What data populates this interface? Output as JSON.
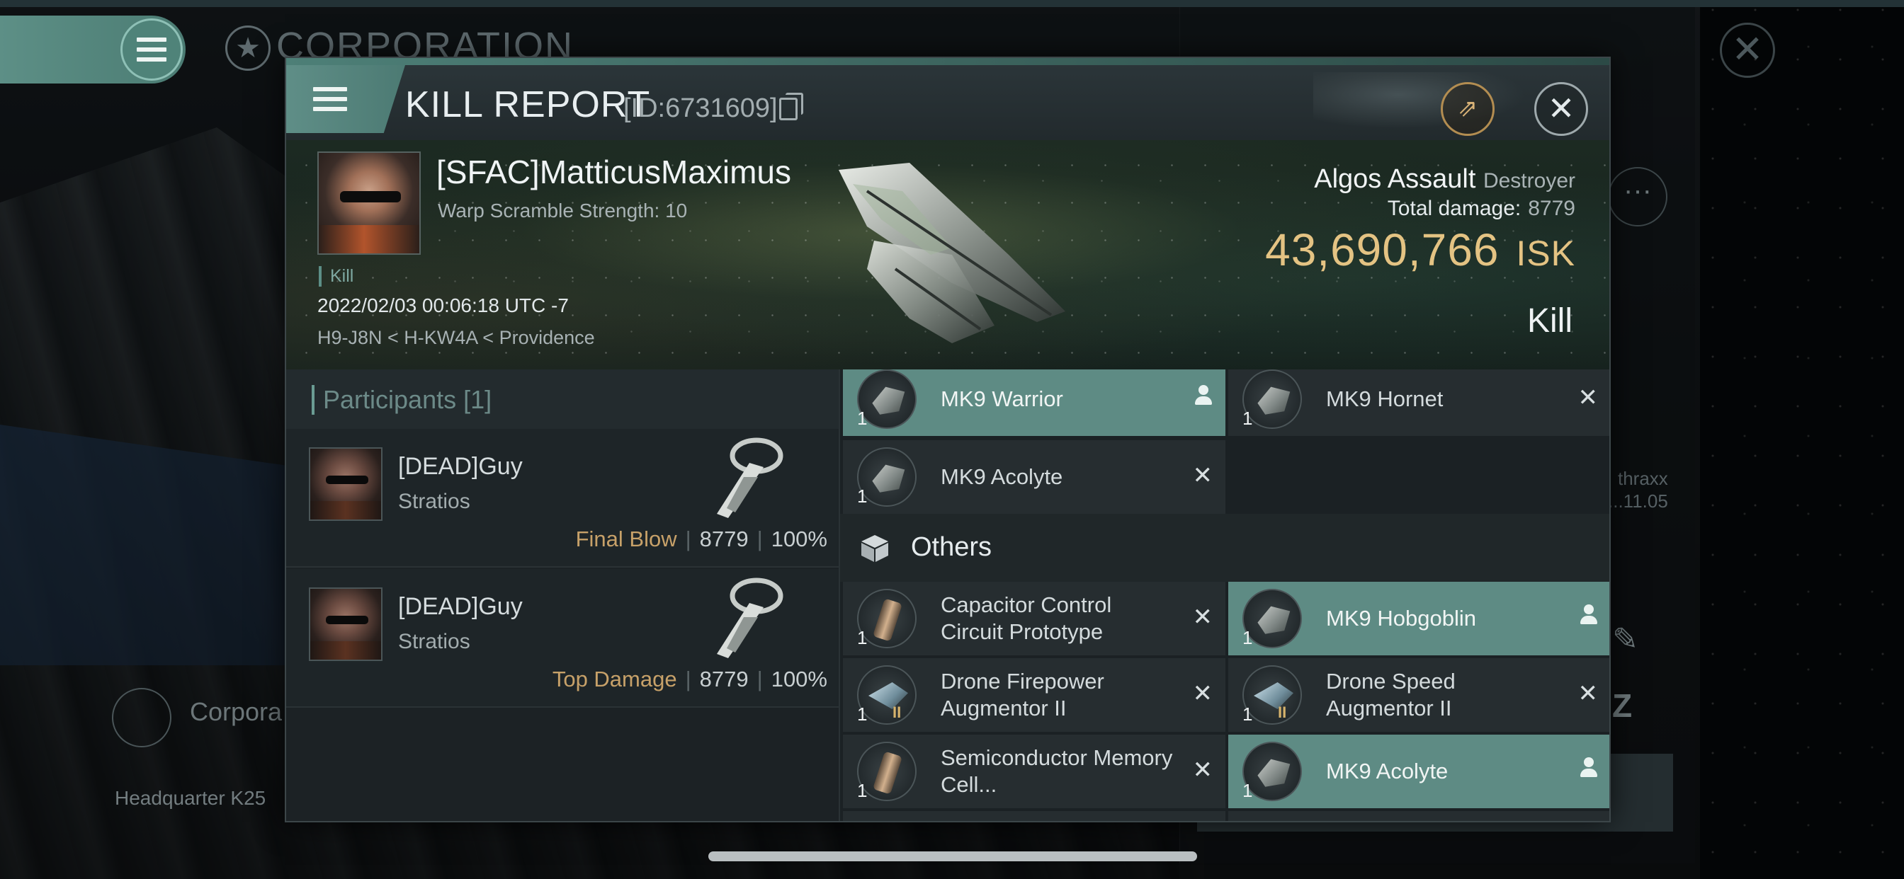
{
  "background": {
    "corp_title": "CORPORATION",
    "corp_sub": "Corpora",
    "headquarter": "Headquarter K25",
    "side_text_line1": "thraxx",
    "side_text_line2": "...11.05"
  },
  "dialog": {
    "title": "KILL REPORT",
    "id_text": "[ID:6731609]",
    "victim": {
      "name": "[SFAC]MatticusMaximus",
      "warp_scramble": "Warp Scramble Strength: 10",
      "tag": "Kill",
      "datetime": "2022/02/03 00:06:18 UTC -7",
      "location": "H9-J8N < H-KW4A < Providence"
    },
    "ship": {
      "name": "Algos Assault",
      "class": "Destroyer",
      "total_damage_label": "Total damage:",
      "total_damage": "8779",
      "isk_value": "43,690,766",
      "isk_unit": "ISK",
      "result": "Kill"
    },
    "participants": {
      "header": "Participants [1]",
      "rows": [
        {
          "name": "[DEAD]Guy",
          "ship": "Stratios",
          "tag": "Final Blow",
          "damage": "8779",
          "percent": "100%"
        },
        {
          "name": "[DEAD]Guy",
          "ship": "Stratios",
          "tag": "Top Damage",
          "damage": "8779",
          "percent": "100%"
        }
      ]
    },
    "items": {
      "drones": [
        {
          "qty": "1",
          "name": "MK9  Warrior",
          "status": "dropped",
          "icon": "drone-warrior-icon"
        },
        {
          "qty": "1",
          "name": "MK9  Hornet",
          "status": "destroyed",
          "icon": "drone-hornet-icon"
        },
        {
          "qty": "1",
          "name": "MK9  Acolyte",
          "status": "destroyed",
          "icon": "drone-acolyte-icon"
        }
      ],
      "others_label": "Others",
      "others": [
        {
          "qty": "1",
          "name": "Capacitor Control Circuit Prototype",
          "status": "destroyed",
          "icon": "rig-capacitor-icon"
        },
        {
          "qty": "1",
          "name": "MK9  Hobgoblin",
          "status": "dropped",
          "icon": "drone-hobgoblin-icon"
        },
        {
          "qty": "1",
          "name": "Drone Firepower Augmentor II",
          "status": "destroyed",
          "icon": "drone-augmentor-icon"
        },
        {
          "qty": "1",
          "name": "Drone Speed Augmentor II",
          "status": "destroyed",
          "icon": "drone-augmentor-icon"
        },
        {
          "qty": "1",
          "name": "Semiconductor Memory Cell...",
          "status": "destroyed",
          "icon": "rig-memory-cell-icon"
        },
        {
          "qty": "1",
          "name": "MK9  Acolyte",
          "status": "dropped",
          "icon": "drone-acolyte-icon"
        }
      ]
    }
  },
  "colors": {
    "accent_teal": "#5e8b84",
    "isk_gold": "#e4c383",
    "blow_tag": "#c7a169"
  }
}
